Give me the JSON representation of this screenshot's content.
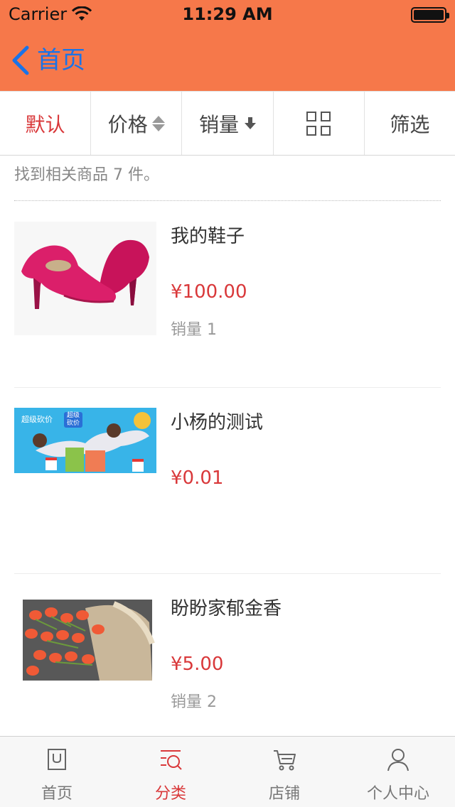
{
  "status_bar": {
    "carrier": "Carrier",
    "time": "11:29 AM"
  },
  "nav": {
    "back_label": "首页",
    "back_icon": "chevron-left-icon",
    "bar_color": "#f6784a",
    "back_color": "#1a73e8"
  },
  "sortbar": {
    "items": [
      {
        "label": "默认",
        "active": true
      },
      {
        "label": "价格",
        "icon": "sort-updown-icon"
      },
      {
        "label": "销量",
        "icon": "arrow-down-icon"
      },
      {
        "label": "",
        "icon": "grid-view-icon"
      },
      {
        "label": "筛选"
      }
    ],
    "active_color": "#d9383a"
  },
  "results": {
    "count_text": "找到相关商品 7 件。"
  },
  "products": [
    {
      "name": "我的鞋子",
      "price": "¥100.00",
      "sales": "销量 1",
      "image": "pink-high-heels"
    },
    {
      "name": "小杨的测试",
      "price": "¥0.01",
      "sales": "",
      "image": "bargain-banner",
      "banner_text_1": "超级砍价",
      "banner_text_2": "超级砍价"
    },
    {
      "name": "盼盼家郁金香",
      "price": "¥5.00",
      "sales": "销量 2",
      "image": "tulip-bouquet"
    }
  ],
  "tabbar": {
    "items": [
      {
        "label": "首页",
        "icon": "home-bag-icon",
        "active": false
      },
      {
        "label": "分类",
        "icon": "category-search-icon",
        "active": true
      },
      {
        "label": "店铺",
        "icon": "cart-icon",
        "active": false
      },
      {
        "label": "个人中心",
        "icon": "user-icon",
        "active": false
      }
    ]
  }
}
